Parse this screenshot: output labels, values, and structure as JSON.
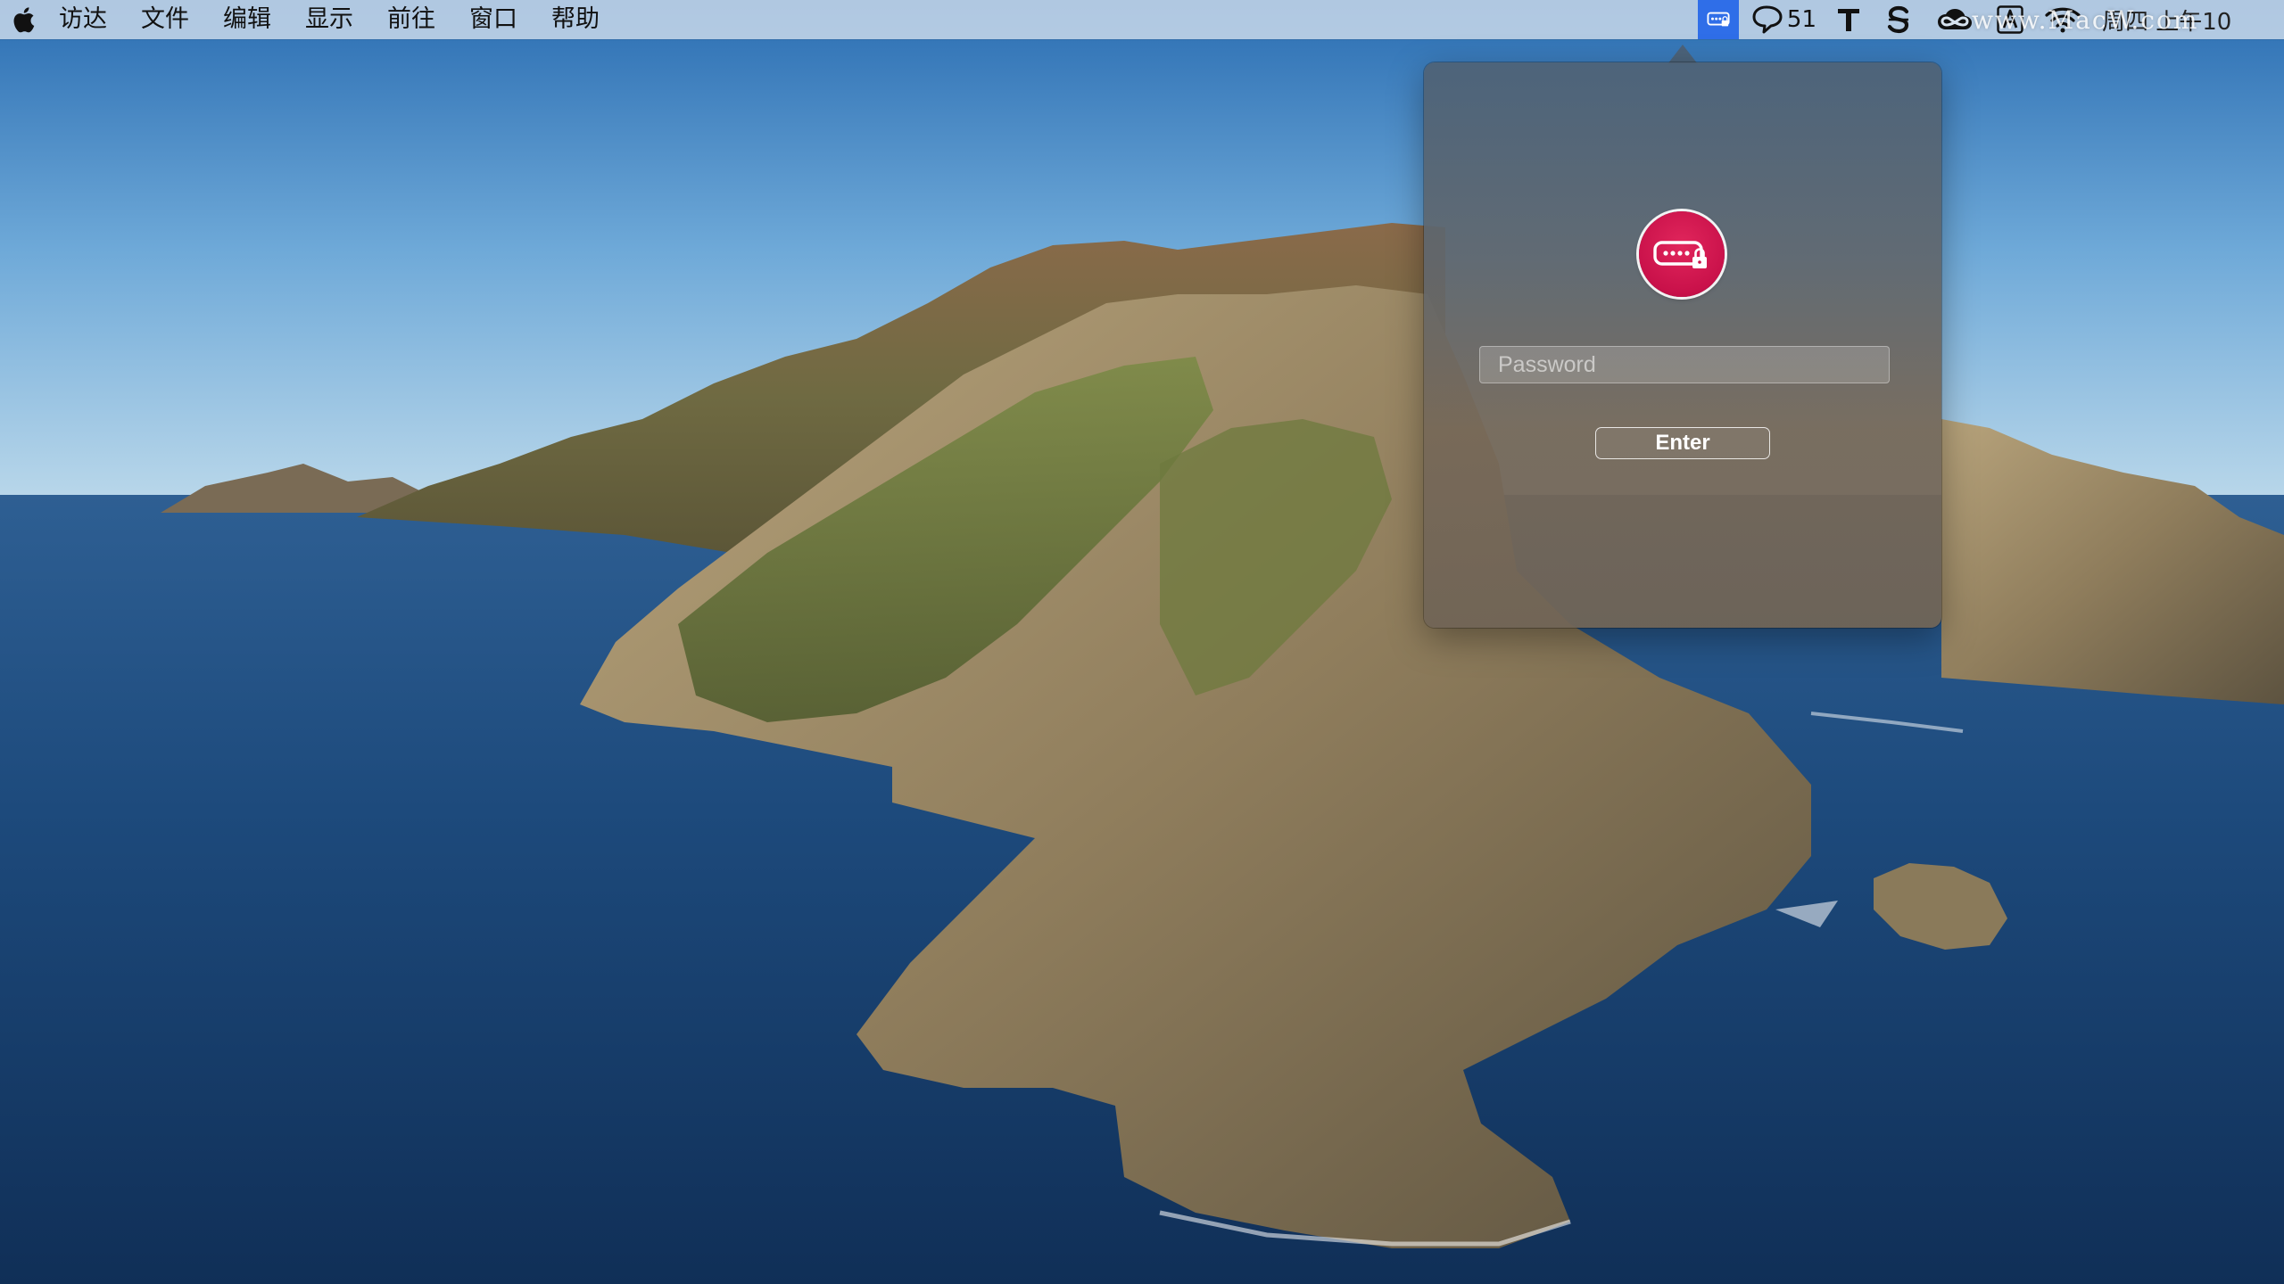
{
  "menubar": {
    "apple_icon": "apple-logo-icon",
    "items": [
      {
        "label": "访达"
      },
      {
        "label": "文件"
      },
      {
        "label": "编辑"
      },
      {
        "label": "显示"
      },
      {
        "label": "前往"
      },
      {
        "label": "窗口"
      },
      {
        "label": "帮助"
      }
    ],
    "status": {
      "active_app_icon": "password-manager-icon",
      "chat_icon": "chat-bubble-icon",
      "chat_count": "51",
      "typora_icon": "t-letter-icon",
      "scrivener_icon": "s-letter-icon",
      "creative_cloud_icon": "creative-cloud-icon",
      "input_source_icon": "a-letter-icon",
      "wifi_icon": "wifi-icon",
      "clock_partial": "周四 上午10"
    },
    "watermark": "www.MacW.com"
  },
  "popover": {
    "lock_icon": "password-lock-icon",
    "password_placeholder": "Password",
    "password_value": "",
    "enter_label": "Enter"
  },
  "colors": {
    "accent_badge": "#c9114a",
    "menubar_active": "#2f6ee8"
  }
}
